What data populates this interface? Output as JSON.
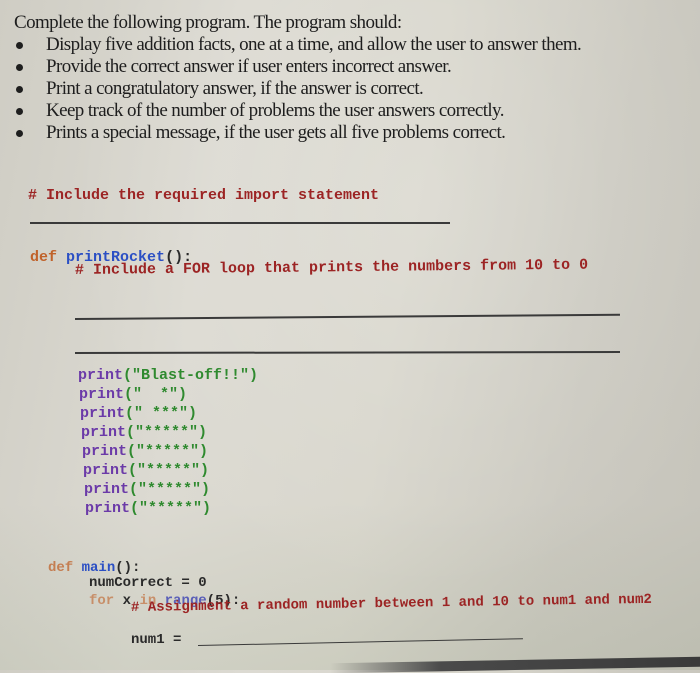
{
  "instructions": {
    "intro": "Complete the following program.  The program should:",
    "requirements": [
      "Display five addition facts, one at a time, and allow the user to answer them.",
      "Provide the correct answer if user enters incorrect answer.",
      "Print a congratulatory answer, if the answer is correct.",
      "Keep track of the number of problems the user answers correctly.",
      "Prints a special message, if the user gets all five problems correct."
    ]
  },
  "code": {
    "import_comment": "# Include the required import statement",
    "rocket_def_keyword": "def",
    "rocket_def_name": "printRocket",
    "rocket_def_suffix": "():",
    "for_loop_comment": "# Include a FOR loop that prints the numbers from 10 to 0",
    "prints": [
      {
        "fn": "print",
        "arg": "(\"Blast-off!!\")"
      },
      {
        "fn": "print",
        "arg": "(\"  *\")"
      },
      {
        "fn": "print",
        "arg": "(\" ***\")"
      },
      {
        "fn": "print",
        "arg": "(\"*****\")"
      },
      {
        "fn": "print",
        "arg": "(\"*****\")"
      },
      {
        "fn": "print",
        "arg": "(\"*****\")"
      },
      {
        "fn": "print",
        "arg": "(\"*****\")"
      },
      {
        "fn": "print",
        "arg": "(\"*****\")"
      }
    ],
    "main_def_keyword": "def",
    "main_def_name": "main",
    "main_def_suffix": "():",
    "num_correct_line": "numCorrect = 0",
    "for_kw": "for",
    "for_var": " x ",
    "in_kw": "in",
    "range_call": "range",
    "range_args": "(5):",
    "assign_comment": "# Assignment a random number between 1 and 10 to num1 and num2",
    "num1_line": "num1 ="
  }
}
